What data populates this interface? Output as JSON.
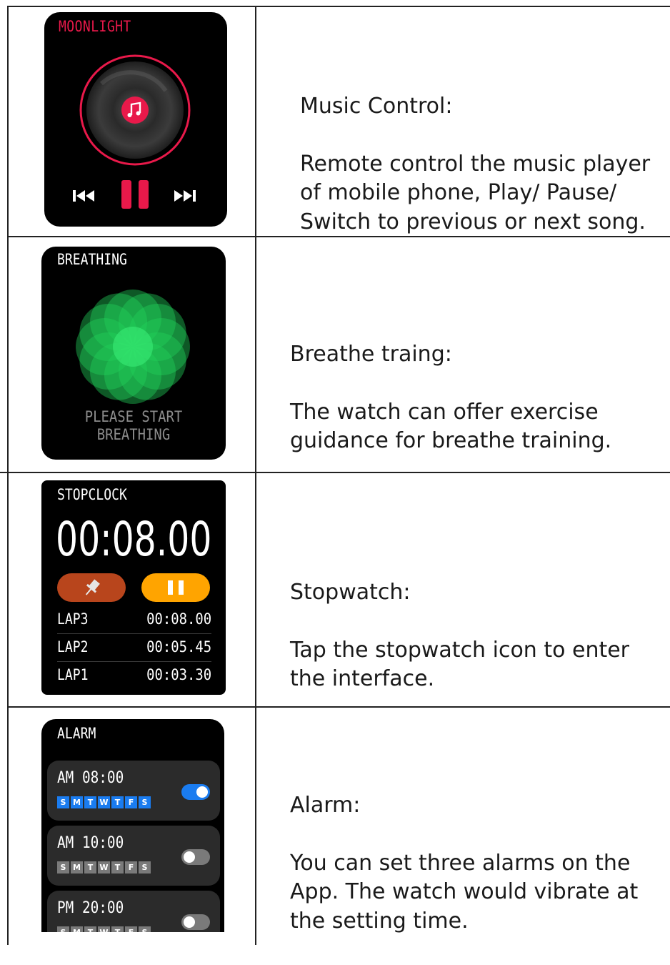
{
  "rows": [
    {
      "screen": {
        "title": "MOONLIGHT",
        "icons": [
          "vinyl-record-icon",
          "music-note-icon",
          "previous-track-icon",
          "pause-icon",
          "next-track-icon"
        ]
      },
      "description": {
        "heading": "Music Control:",
        "text": "Remote control the music player\nof mobile phone, Play/ Pause/\nSwitch to previous or next song."
      }
    },
    {
      "screen": {
        "title": "BREATHING",
        "message_line1": "PLEASE START",
        "message_line2": "BREATHING",
        "icons": [
          "breathing-flower-icon"
        ]
      },
      "description": {
        "heading": "Breathe traing:",
        "text": "The watch can offer exercise\nguidance for breathe training."
      }
    },
    {
      "screen": {
        "title": "STOPCLOCK",
        "time": "00:08.00",
        "icons": [
          "pin-icon",
          "pause-icon"
        ],
        "laps": [
          {
            "name": "LAP3",
            "value": "00:08.00"
          },
          {
            "name": "LAP2",
            "value": "00:05.45"
          },
          {
            "name": "LAP1",
            "value": "00:03.30"
          }
        ]
      },
      "description": {
        "heading": "Stopwatch:",
        "text": "Tap the stopwatch icon to enter\nthe interface."
      }
    },
    {
      "screen": {
        "title": "ALARM",
        "alarms": [
          {
            "time": "AM 08:00",
            "days": [
              "S",
              "M",
              "T",
              "W",
              "T",
              "F",
              "S"
            ],
            "enabled": true
          },
          {
            "time": "AM 10:00",
            "days": [
              "S",
              "M",
              "T",
              "W",
              "T",
              "F",
              "S"
            ],
            "enabled": false
          },
          {
            "time": "PM 20:00",
            "days": [
              "S",
              "M",
              "T",
              "W",
              "T",
              "F",
              "S"
            ],
            "enabled": false
          }
        ]
      },
      "description": {
        "heading": "Alarm:",
        "text": "You can set three alarms on the\nApp. The watch would vibrate at\nthe setting time."
      }
    }
  ],
  "colors": {
    "music_accent": "#e8194a",
    "breath_green": "#22d15a",
    "stop_pin": "#b8451c",
    "stop_pause": "#ffa400",
    "alarm_on": "#1a7cf0",
    "alarm_off": "#7a7a7a"
  }
}
